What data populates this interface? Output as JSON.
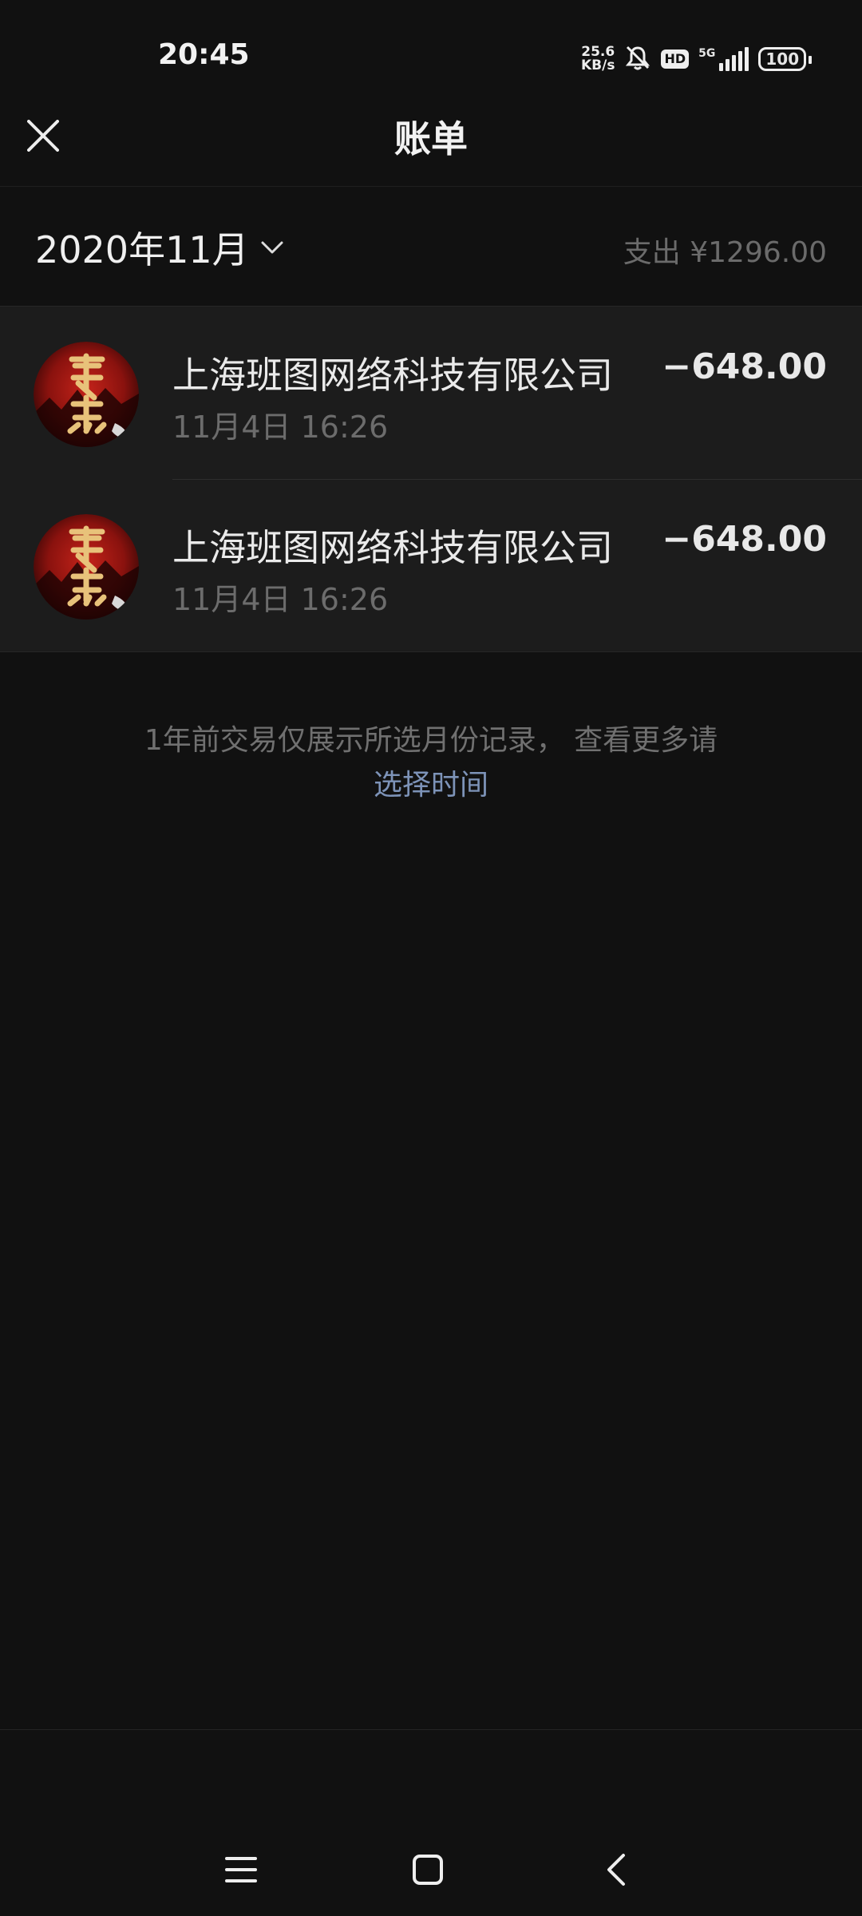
{
  "status_bar": {
    "time": "20:45",
    "net_speed_value": "25.6",
    "net_speed_unit": "KB/s",
    "hd_label": "HD",
    "network_type": "5G",
    "battery": "100"
  },
  "nav": {
    "title": "账单",
    "close_icon": "close-icon"
  },
  "month_bar": {
    "selected_month": "2020年11月",
    "total_label": "支出 ¥1296.00"
  },
  "transactions": [
    {
      "merchant": "上海班图网络科技有限公司",
      "time": "11月4日 16:26",
      "amount": "−648.00"
    },
    {
      "merchant": "上海班图网络科技有限公司",
      "time": "11月4日 16:26",
      "amount": "−648.00"
    }
  ],
  "footer": {
    "note": "1年前交易仅展示所选月份记录， 查看更多请",
    "link": "选择时间"
  },
  "colors": {
    "background": "#111111",
    "list_background": "#1c1c1c",
    "link": "#7d93b8"
  }
}
